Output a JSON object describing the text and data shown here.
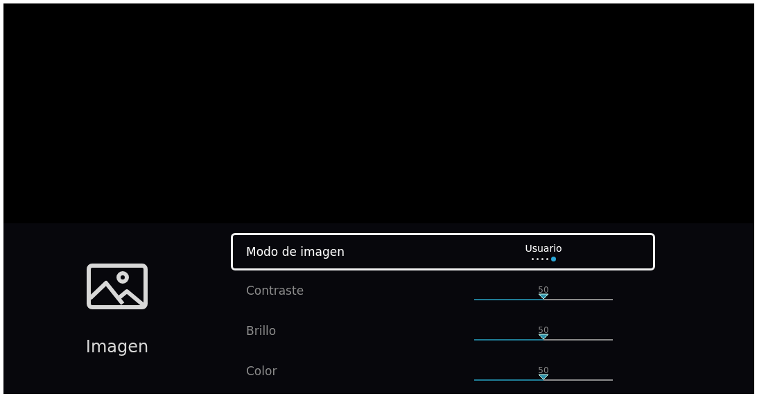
{
  "category": {
    "label": "Imagen"
  },
  "settings": [
    {
      "kind": "selector",
      "label": "Modo de imagen",
      "selected": true,
      "value": "Usuario",
      "dots": [
        {
          "selected": false
        },
        {
          "selected": false
        },
        {
          "selected": false
        },
        {
          "selected": false
        },
        {
          "selected": true
        }
      ]
    },
    {
      "kind": "slider",
      "label": "Contraste",
      "selected": false,
      "value": "50",
      "level": 0.5
    },
    {
      "kind": "slider",
      "label": "Brillo",
      "selected": false,
      "value": "50",
      "level": 0.5
    },
    {
      "kind": "slider",
      "label": "Color",
      "selected": false,
      "value": "50",
      "level": 0.5
    }
  ]
}
